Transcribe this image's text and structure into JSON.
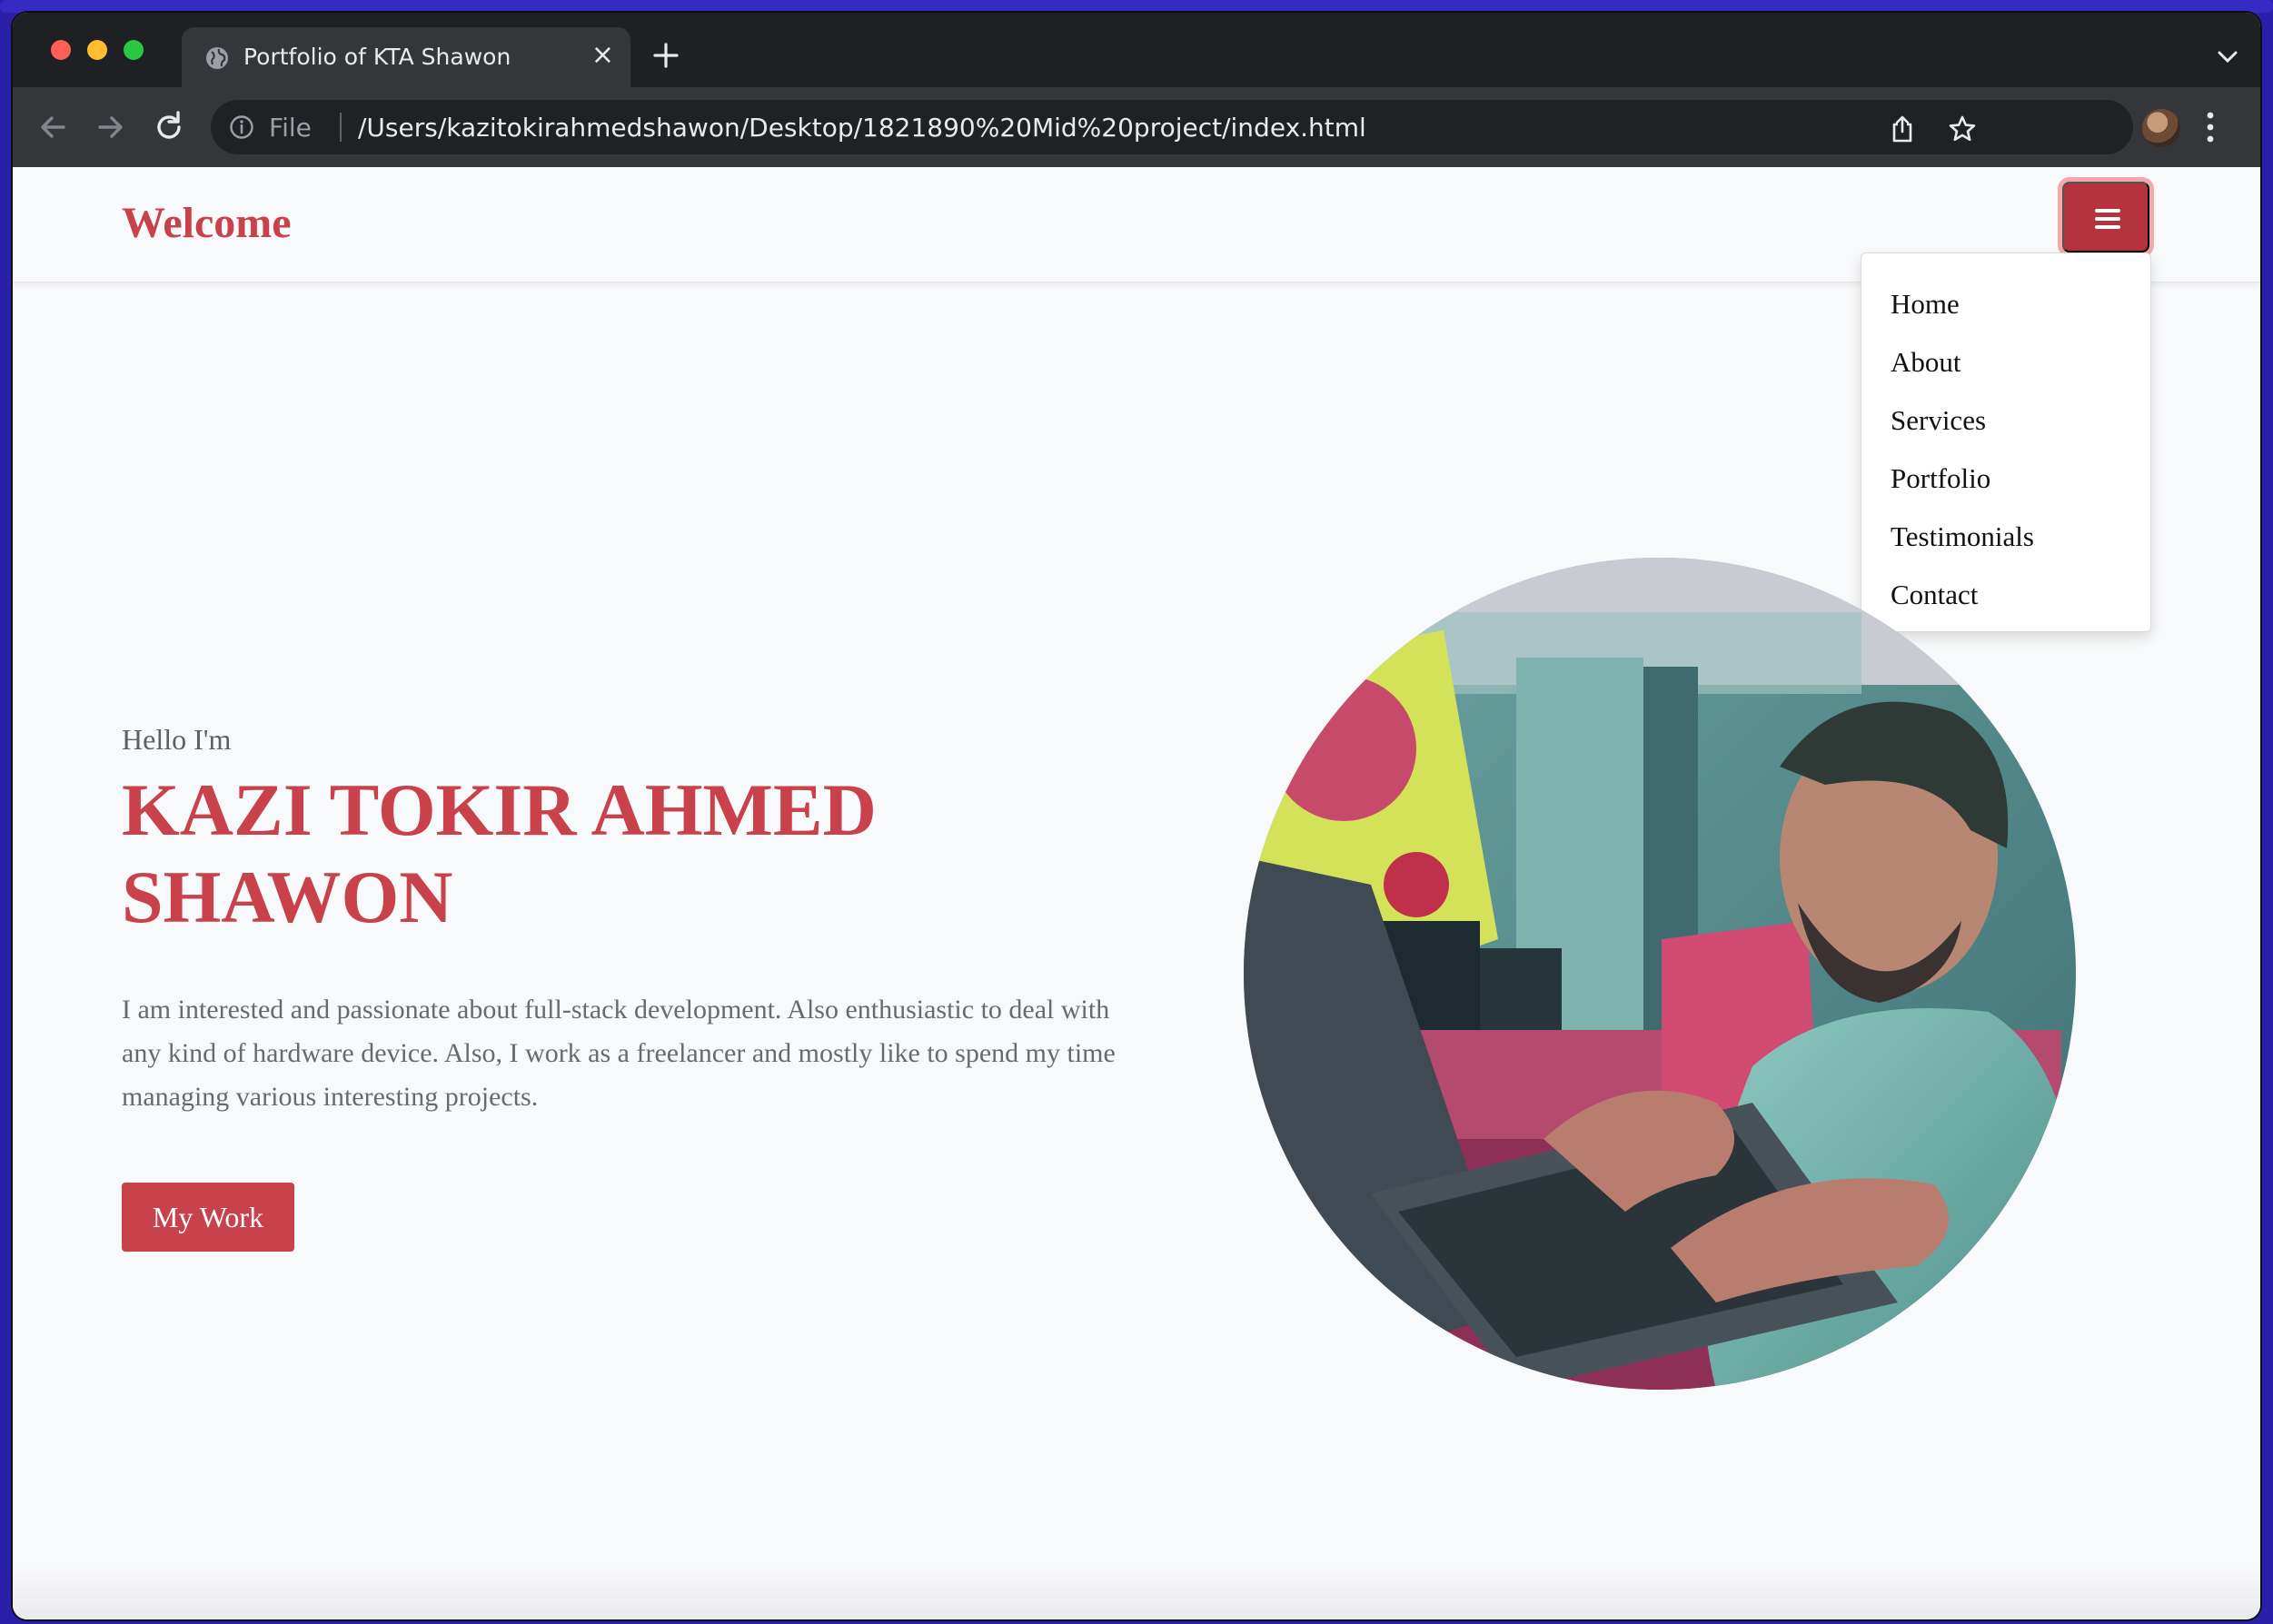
{
  "browser": {
    "tab_title": "Portfolio of KTA Shawon",
    "tab_close": "×",
    "file_label": "File",
    "url": "/Users/kazitokirahmedshawon/Desktop/1821890%20Mid%20project/index.html",
    "icons": [
      "globe-icon",
      "close-icon",
      "plus-icon",
      "chevron-down-icon",
      "back-arrow-icon",
      "forward-arrow-icon",
      "reload-icon",
      "info-icon",
      "share-icon",
      "star-icon",
      "kebab-menu-icon"
    ]
  },
  "navbar": {
    "brand": "Welcome",
    "toggle_icon": "hamburger-icon",
    "toggle_color": "#b5333c",
    "menu_items": [
      "Home",
      "About",
      "Services",
      "Portfolio",
      "Testimonials",
      "Contact"
    ]
  },
  "hero": {
    "greeting": "Hello I'm",
    "name": "KAZI TOKIR AHMED SHAWON",
    "bio": "I am interested and passionate about full-stack development. Also enthusiastic to deal with any kind of hardware device. Also, I work as a freelancer and mostly like to spend my time managing various interesting projects.",
    "cta_label": "My Work",
    "accent_color": "#c9414a"
  }
}
